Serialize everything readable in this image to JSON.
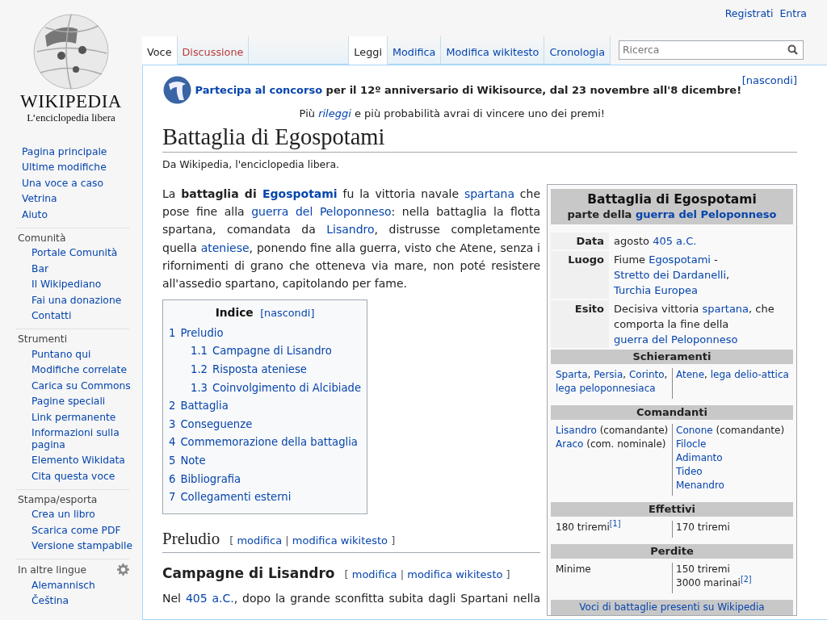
{
  "logo": {
    "wordmark": "WIKIPEDIA",
    "tagline": "L’enciclopedia libera"
  },
  "personal_links": [
    "Registrati",
    "Entra"
  ],
  "sidebar": {
    "navigation": [
      "Pagina principale",
      "Ultime modifiche",
      "Una voce a caso",
      "Vetrina",
      "Aiuto"
    ],
    "portals": [
      {
        "heading": "Comunità",
        "items": [
          "Portale Comunità",
          "Bar",
          "Il Wikipediano",
          "Fai una donazione",
          "Contatti"
        ]
      },
      {
        "heading": "Strumenti",
        "items": [
          "Puntano qui",
          "Modifiche correlate",
          "Carica su Commons",
          "Pagine speciali",
          "Link permanente",
          "Informazioni sulla pagina",
          "Elemento Wikidata",
          "Cita questa voce"
        ]
      },
      {
        "heading": "Stampa/esporta",
        "items": [
          "Crea un libro",
          "Scarica come PDF",
          "Versione stampabile"
        ]
      },
      {
        "heading": "In altre lingue",
        "kind": "languages",
        "items": [
          "Alemannisch",
          "Čeština"
        ]
      }
    ]
  },
  "tabs_left": [
    {
      "label": "Voce",
      "selected": true,
      "missing": false
    },
    {
      "label": "Discussione",
      "selected": false,
      "missing": true
    }
  ],
  "tabs_right": [
    {
      "label": "Leggi",
      "selected": true
    },
    {
      "label": "Modifica",
      "selected": false
    },
    {
      "label": "Modifica wikitesto",
      "selected": false
    },
    {
      "label": "Cronologia",
      "selected": false
    }
  ],
  "search": {
    "placeholder": "Ricerca"
  },
  "banner": {
    "hide": "[nascondi]",
    "line_1": [
      {
        "kind": "bold-link",
        "text": "Partecipa al concorso"
      },
      {
        "kind": "bold",
        "text": " per il 12º anniversario di Wikisource, dal 23 novembre all'8 dicembre!"
      }
    ],
    "line_2": [
      {
        "kind": "text",
        "text": "Più "
      },
      {
        "kind": "italic-link",
        "text": "rileggi"
      },
      {
        "kind": "text",
        "text": " e più probabilità avrai di vincere uno dei premi!"
      }
    ]
  },
  "title": "Battaglia di Egospotami",
  "site_sub": "Da Wikipedia, l'enciclopedia libera.",
  "intro": [
    {
      "kind": "text",
      "text": "La "
    },
    {
      "kind": "bold",
      "text": "battaglia di "
    },
    {
      "kind": "bold-link",
      "text": "Egospotami"
    },
    {
      "kind": "text",
      "text": " fu la vittoria navale "
    },
    {
      "kind": "link",
      "text": "spartana"
    },
    {
      "kind": "text",
      "text": " che pose fine alla "
    },
    {
      "kind": "link",
      "text": "guerra del Peloponneso"
    },
    {
      "kind": "text",
      "text": ": nella battaglia la flotta spartana, comandata da "
    },
    {
      "kind": "link",
      "text": "Lisandro"
    },
    {
      "kind": "text",
      "text": ", distrusse completamente quella "
    },
    {
      "kind": "link",
      "text": "ateniese"
    },
    {
      "kind": "text",
      "text": ", ponendo fine alla guerra, visto che Atene, senza i rifornimenti di grano che otteneva via mare, non poté resistere all'assedio spartano, capitolando per fame."
    }
  ],
  "toc": {
    "title": "Indice",
    "hide": "[nascondi]",
    "items": [
      {
        "number": "1",
        "label": "Preludio",
        "children": [
          {
            "number": "1.1",
            "label": "Campagne di Lisandro"
          },
          {
            "number": "1.2",
            "label": "Risposta ateniese"
          },
          {
            "number": "1.3",
            "label": "Coinvolgimento di Alcibiade"
          }
        ]
      },
      {
        "number": "2",
        "label": "Battaglia"
      },
      {
        "number": "3",
        "label": "Conseguenze"
      },
      {
        "number": "4",
        "label": "Commemorazione della battaglia"
      },
      {
        "number": "5",
        "label": "Note"
      },
      {
        "number": "6",
        "label": "Bibliografia"
      },
      {
        "number": "7",
        "label": "Collegamenti esterni"
      }
    ]
  },
  "sections": [
    {
      "kind": "h2",
      "title": "Preludio",
      "edit_links": [
        {
          "kind": "bracket",
          "text": "["
        },
        {
          "kind": "link",
          "text": "modifica"
        },
        {
          "kind": "separator",
          "text": "|"
        },
        {
          "kind": "link",
          "text": "modifica wikitesto"
        },
        {
          "kind": "bracket",
          "text": "]"
        }
      ]
    },
    {
      "kind": "h3",
      "title": "Campagne di Lisandro",
      "edit_links": [
        {
          "kind": "bracket",
          "text": "["
        },
        {
          "kind": "link",
          "text": "modifica"
        },
        {
          "kind": "separator",
          "text": "|"
        },
        {
          "kind": "link",
          "text": "modifica wikitesto"
        },
        {
          "kind": "bracket",
          "text": "]"
        }
      ]
    },
    {
      "kind": "paragraph",
      "runs": [
        {
          "kind": "text",
          "text": "Nel "
        },
        {
          "kind": "link",
          "text": "405 a.C."
        },
        {
          "kind": "text",
          "text": ", dopo la grande sconfitta subita dagli Spartani nella"
        }
      ]
    }
  ],
  "infobox": {
    "title": "Battaglia di Egospotami",
    "subtitle": [
      {
        "kind": "bold",
        "text": "parte della "
      },
      {
        "kind": "bold-link",
        "text": "guerra del Peloponneso"
      }
    ],
    "rows": [
      {
        "label": "Data",
        "value": [
          {
            "kind": "text",
            "text": "agosto "
          },
          {
            "kind": "link",
            "text": "405 a.C."
          }
        ]
      },
      {
        "label": "Luogo",
        "value": [
          {
            "kind": "text",
            "text": "Fiume "
          },
          {
            "kind": "link",
            "text": "Egospotami"
          },
          {
            "kind": "text",
            "text": " - "
          },
          {
            "kind": "link",
            "text": "Stretto dei Dardanelli"
          },
          {
            "kind": "text",
            "text": ", "
          },
          {
            "kind": "link",
            "text": "Turchia Europea"
          }
        ]
      },
      {
        "label": "Esito",
        "value": [
          {
            "kind": "text",
            "text": "Decisiva vittoria "
          },
          {
            "kind": "link",
            "text": "spartana"
          },
          {
            "kind": "text",
            "text": ", che comporta la fine della "
          },
          {
            "kind": "link",
            "text": "guerra del Peloponneso"
          }
        ]
      }
    ],
    "sections": [
      {
        "title": "Schieramenti",
        "columns": [
          [
            [
              {
                "kind": "link",
                "text": "Sparta"
              },
              {
                "kind": "text",
                "text": ", "
              },
              {
                "kind": "link",
                "text": "Persia"
              },
              {
                "kind": "text",
                "text": ", "
              },
              {
                "kind": "link",
                "text": "Corinto"
              },
              {
                "kind": "text",
                "text": ", "
              },
              {
                "kind": "link",
                "text": "lega peloponnesiaca"
              }
            ]
          ],
          [
            [
              {
                "kind": "link",
                "text": "Atene"
              },
              {
                "kind": "text",
                "text": ", "
              },
              {
                "kind": "link",
                "text": "lega delio-attica"
              }
            ]
          ]
        ]
      },
      {
        "title": "Comandanti",
        "columns": [
          [
            [
              {
                "kind": "link",
                "text": "Lisandro"
              },
              {
                "kind": "text",
                "text": " (comandante)"
              }
            ],
            [
              {
                "kind": "link",
                "text": "Araco"
              },
              {
                "kind": "text",
                "text": " (com. nominale)"
              }
            ]
          ],
          [
            [
              {
                "kind": "link",
                "text": "Conone"
              },
              {
                "kind": "text",
                "text": " (comandante)"
              }
            ],
            [
              {
                "kind": "link",
                "text": "Filocle"
              }
            ],
            [
              {
                "kind": "link",
                "text": "Adimanto"
              }
            ],
            [
              {
                "kind": "link",
                "text": "Tideo"
              }
            ],
            [
              {
                "kind": "link",
                "text": "Menandro"
              }
            ]
          ]
        ]
      },
      {
        "title": "Effettivi",
        "columns": [
          [
            [
              {
                "kind": "text",
                "text": "180 triremi"
              },
              {
                "kind": "ref",
                "text": "[1]"
              }
            ]
          ],
          [
            [
              {
                "kind": "text",
                "text": "170 triremi"
              }
            ]
          ]
        ]
      },
      {
        "title": "Perdite",
        "columns": [
          [
            [
              {
                "kind": "text",
                "text": "Minime"
              }
            ]
          ],
          [
            [
              {
                "kind": "text",
                "text": "150 triremi"
              }
            ],
            [
              {
                "kind": "text",
                "text": "3000 marinai"
              },
              {
                "kind": "ref",
                "text": "[2]"
              }
            ]
          ]
        ]
      }
    ],
    "footer": "Voci di battaglie presenti su Wikipedia"
  }
}
